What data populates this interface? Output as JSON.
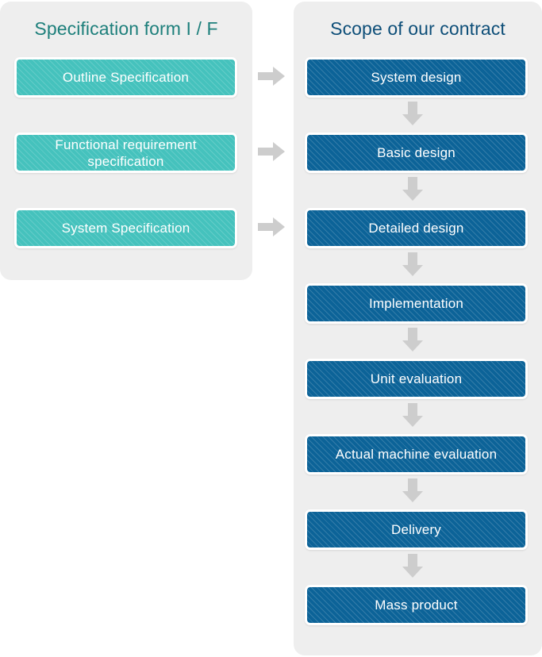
{
  "diagram": {
    "left_panel": {
      "title": "Specification form I / F",
      "title_color": "#1d7f7b",
      "box_color": "#45c2bd",
      "panel_color": "#eeeeee",
      "items": [
        {
          "label": "Outline Specification"
        },
        {
          "label": "Functional requirement\nspecification"
        },
        {
          "label": "System Specification"
        }
      ]
    },
    "right_panel": {
      "title": "Scope of our contract",
      "title_color": "#0d4e78",
      "box_color": "#0c6398",
      "panel_color": "#eeeeee",
      "steps": [
        {
          "label": "System design"
        },
        {
          "label": "Basic design"
        },
        {
          "label": "Detailed design"
        },
        {
          "label": "Implementation"
        },
        {
          "label": "Unit evaluation"
        },
        {
          "label": "Actual machine evaluation"
        },
        {
          "label": "Delivery"
        },
        {
          "label": "Mass product"
        }
      ]
    },
    "connectors": {
      "color": "#cdcdcd",
      "horizontal_icon": "arrow-right-icon",
      "vertical_icon": "arrow-down-icon",
      "horizontal_count": 3,
      "vertical_count": 7
    }
  }
}
